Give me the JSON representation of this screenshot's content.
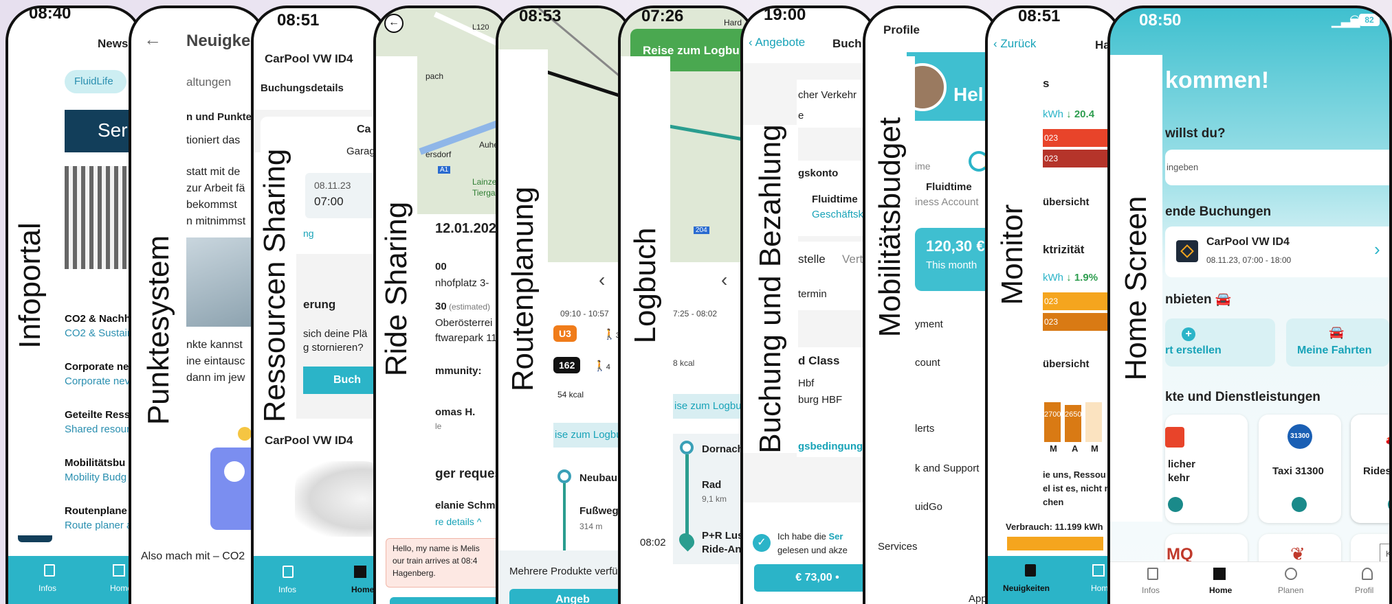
{
  "infoportal": {
    "section_label": "Infoportal",
    "status_time": "08:40",
    "header_title": "News",
    "chip": "FluidLife",
    "banner_text": "Ser",
    "news": [
      {
        "title": "CO2 & Nachha",
        "sub": "CO2 & Sustain"
      },
      {
        "title": "Corporate ne",
        "sub": "Corporate nev"
      },
      {
        "title": "Geteilte Ress",
        "sub": "Shared resour"
      },
      {
        "title": "Mobilitätsbu",
        "sub": "Mobility Budg"
      },
      {
        "title": "Routenplane",
        "sub": "Route planer a"
      }
    ],
    "nav": [
      "Infos",
      "Home"
    ]
  },
  "punktesystem": {
    "section_label": "Punktesystem",
    "header_title": "Neuigkeit",
    "subtab": "altungen",
    "lines": [
      "n und Punkte",
      "tioniert das",
      "statt mit de",
      "zur Arbeit fä",
      "bekommst",
      "n mitnimmst",
      "nkte kannst",
      "ine eintausc",
      "dann im jew"
    ],
    "footer": "Also mach mit – CO2"
  },
  "ressourcen": {
    "section_label": "Ressourcen Sharing",
    "status_time": "08:51",
    "car_title": "CarPool VW ID4",
    "subtitle": "Buchungsdetails",
    "card_title": "Ca",
    "card_sub": "Garag",
    "date": "08.11.23",
    "time": "07:00",
    "small": "ng",
    "section2": "erung",
    "q1": "sich deine Plä",
    "q2": "g stornieren?",
    "button": "Buch",
    "car_title2": "CarPool VW ID4",
    "nav": [
      "Infos",
      "Home"
    ]
  },
  "ride": {
    "section_label": "Ride Sharing",
    "date": "12.01.202",
    "time1": "00",
    "addr1": "nhofplatz 3-",
    "time2": "30",
    "estimated": "(estimated)",
    "addr2": "Oberösterrei",
    "addr3": "ftwarepark 11",
    "community": "mmunity:",
    "driver": "omas H.",
    "driver_sub": "le",
    "request": "ger request",
    "rider": "elanie Schmi",
    "more": "re details",
    "msg": [
      "Hello, my name is Melis",
      "our train arrives at 08:4",
      "Hagenberg."
    ],
    "map_labels": [
      "L120",
      "pach",
      "ersdorf",
      "Auhe",
      "A1",
      "Lainzer",
      "Tiergarte"
    ]
  },
  "routen": {
    "section_label": "Routenplanung",
    "status_time": "08:53",
    "times": "09:10 - 10:57",
    "line1": "U3",
    "walk1": "3",
    "line2": "162",
    "walk2": "4",
    "kcal": "54 kcal",
    "logbuch": "ise zum Logbu",
    "stop1": "Neubau",
    "mode": "Fußweg",
    "dist": "314 m",
    "footer": "Mehrere Produkte verfü",
    "button": "Angeb"
  },
  "logbuch": {
    "section_label": "Logbuch",
    "status_time": "07:26",
    "banner": "Reise zum Logbu",
    "map_label": "Hard",
    "map_num": "204",
    "times": "7:25 - 08:02",
    "kcal": "8 kcal",
    "logbuch": "ise zum Logbuch",
    "stop1": "Dornach",
    "mode": "Rad",
    "dist": "9,1 km",
    "time_end": "08:02",
    "stop2a": "P+R Lus",
    "stop2b": "Ride-An"
  },
  "buchung": {
    "section_label": "Buchung und Bezahlung",
    "status_time": "19:00",
    "back": "Angebote",
    "title": "Buch",
    "l1": "cher Verkehr",
    "l2": "e",
    "konto": "gskonto",
    "fluid": "Fluidtime",
    "fluid_sub": "Geschäftskont",
    "stelle": "stelle",
    "vertr": "Vertri",
    "termin": "termin",
    "class": "d Class",
    "hbf": "Hbf",
    "hbf2": "burg HBF",
    "agb": "gsbedingunge",
    "check1": "Ich habe die",
    "check_link": "Ser",
    "check2": "gelesen und akze",
    "price": "€ 73,00 •"
  },
  "mobil": {
    "section_label": "Mobilitätsbudget",
    "header": "Profile",
    "greet": "Hel",
    "time_small": "ime",
    "fluid": "Fluidtime",
    "fluid_sub": "iness Account",
    "amount": "120,30 €",
    "month": "This month",
    "menu": [
      "yment",
      "count",
      "lerts",
      "k and Support",
      "uidGo"
    ],
    "services": "Services",
    "app": "App"
  },
  "monitor": {
    "section_label": "Monitor",
    "status_time": "08:51",
    "back": "Zurück",
    "title": "Ha",
    "h1": "s",
    "kwh1": "kWh",
    "delta1": "20.4",
    "bars1": [
      "023",
      "023"
    ],
    "ub1": "übersicht",
    "h2": "ktrizität",
    "kwh2": "kWh",
    "delta2": "1.9%",
    "bars2": [
      "023",
      "023"
    ],
    "ub2": "übersicht",
    "chart_labels": [
      "2700",
      "2650"
    ],
    "months": [
      "M",
      "A",
      "M"
    ],
    "note": [
      "ie uns, Ressou",
      "el ist es, nicht m",
      "chen"
    ],
    "verbrauch": "Verbrauch: 11.199 kWh",
    "nav": [
      "Neuigkeiten",
      "Home"
    ]
  },
  "home": {
    "section_label": "Home Screen",
    "status_time": "08:50",
    "battery": "82",
    "welcome": "kommen!",
    "q": "willst du?",
    "search_ph": "ingeben",
    "bookings": "ende Buchungen",
    "booking_title": "CarPool VW ID4",
    "booking_sub": "08.11.23, 07:00 - 18:00",
    "offer": "nbieten",
    "btn1": "rt erstellen",
    "btn2": "Meine Fahrten",
    "services_h": "kte und Dienstleistungen",
    "tiles": [
      "licher\nkehr",
      "Taxi 31300",
      "Ridesharing"
    ],
    "tile_lines": [
      "licher",
      "kehr"
    ],
    "taxi_badge": "31300",
    "logos": [
      "MQ",
      "KS"
    ],
    "nav": [
      "Infos",
      "Home",
      "Planen",
      "Profil"
    ]
  },
  "colors": {
    "teal": "#2bb4c8",
    "brand_dark": "#123e5a",
    "orange": "#f07c1a",
    "red": "#e8442a"
  }
}
